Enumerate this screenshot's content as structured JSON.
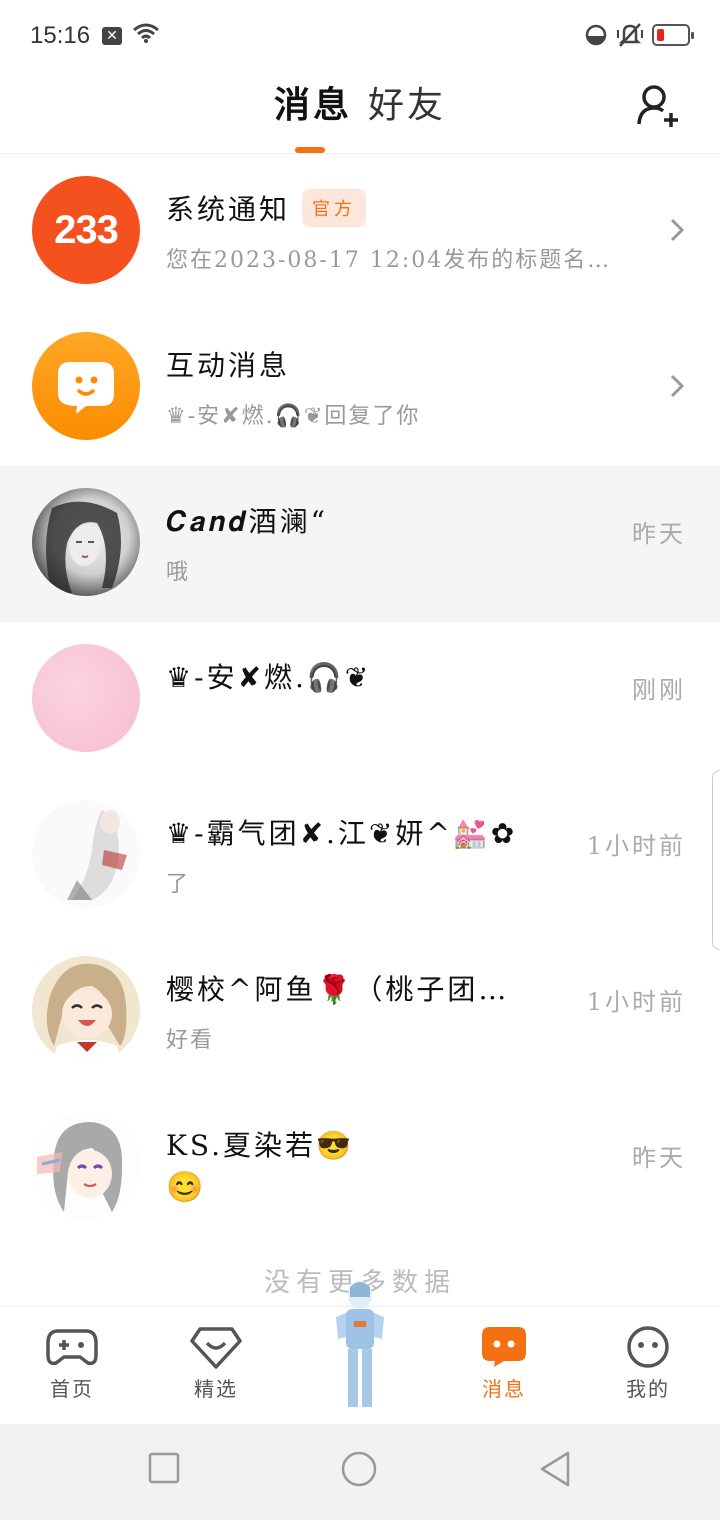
{
  "status": {
    "time": "15:16"
  },
  "header": {
    "tabs": [
      {
        "label": "消息",
        "active": true
      },
      {
        "label": "好友",
        "active": false
      }
    ]
  },
  "conversations": [
    {
      "title": "系统通知",
      "badge": "官方",
      "subtitle": "您在2023-08-17 12:04发布的标题名…",
      "time": "",
      "chevron": true
    },
    {
      "title": "互动消息",
      "badge": "",
      "subtitle": "♛-安✘燃.🎧❦回复了你",
      "time": "",
      "chevron": true
    },
    {
      "title": "𝑪𝒂𝒏𝒅酒澜“",
      "badge": "",
      "subtitle": "哦",
      "time": "昨天",
      "chevron": false
    },
    {
      "title": "♛-安✘燃.🎧❦",
      "badge": "",
      "subtitle": "",
      "time": "刚刚",
      "chevron": false
    },
    {
      "title": "♛-霸气团✘.江❦妍^💒✿",
      "badge": "",
      "subtitle": "了",
      "time": "1小时前",
      "chevron": false
    },
    {
      "title": "樱校^阿鱼🌹（桃子团…",
      "badge": "",
      "subtitle": "好看",
      "time": "1小时前",
      "chevron": false
    },
    {
      "title": "KS.夏染若😎",
      "badge": "",
      "subtitle": "😊",
      "time": "昨天",
      "chevron": false
    }
  ],
  "system_avatar_text": "233",
  "footer_text": "没有更多数据",
  "bottom_nav": [
    {
      "label": "首页"
    },
    {
      "label": "精选"
    },
    {
      "label": "消息"
    },
    {
      "label": "我的"
    }
  ],
  "colors": {
    "accent": "#f37013",
    "badge_bg": "#fde7dc",
    "highlight_row": "#f5f5f5"
  }
}
